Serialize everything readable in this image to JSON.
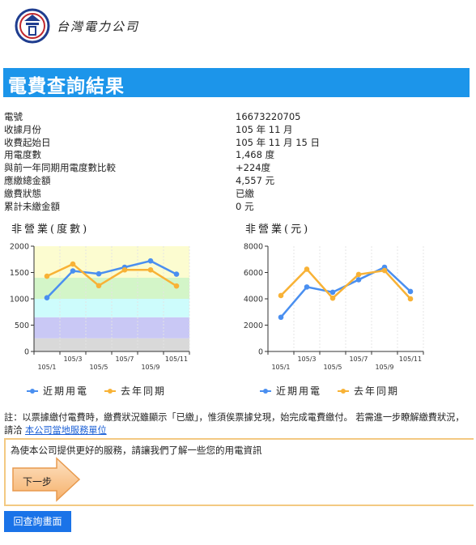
{
  "logo": {
    "company": "台灣電力公司"
  },
  "page_title": "電費查詢結果",
  "info": [
    {
      "label": "電號",
      "value": "16673220705"
    },
    {
      "label": "收據月份",
      "value": "105 年 11 月"
    },
    {
      "label": "收費起始日",
      "value": "105 年 11 月 15 日"
    },
    {
      "label": "用電度數",
      "value": "1,468 度"
    },
    {
      "label": "與前一年同期用電度數比較",
      "value": "+224度"
    },
    {
      "label": "應繳總金額",
      "value": "4,557 元"
    },
    {
      "label": "繳費狀態",
      "value": "已繳"
    },
    {
      "label": "累計未繳金額",
      "value": "0 元"
    }
  ],
  "chart_data": [
    {
      "type": "line",
      "title": "非營業(度數)",
      "x": [
        "105/1",
        "105/3",
        "105/5",
        "105/7",
        "105/9",
        "105/11"
      ],
      "ylim": [
        0,
        2000
      ],
      "yticks": [
        0,
        500,
        1000,
        1500,
        2000
      ],
      "series": [
        {
          "name": "近期用電",
          "color": "#4a8ff0",
          "values": [
            1020,
            1530,
            1475,
            1600,
            1720,
            1468
          ]
        },
        {
          "name": "去年同期",
          "color": "#f8b236",
          "values": [
            1430,
            1660,
            1250,
            1550,
            1550,
            1244
          ]
        }
      ],
      "bands": [
        {
          "from": 0,
          "to": 250,
          "color": "#d9d9d9"
        },
        {
          "from": 250,
          "to": 650,
          "color": "#c9c8f5"
        },
        {
          "from": 650,
          "to": 1000,
          "color": "#cdfcfc"
        },
        {
          "from": 1000,
          "to": 1400,
          "color": "#d3f5c8"
        },
        {
          "from": 1400,
          "to": 2000,
          "color": "#fcfcd0"
        }
      ]
    },
    {
      "type": "line",
      "title": "非營業(元)",
      "x": [
        "105/1",
        "105/3",
        "105/5",
        "105/7",
        "105/9",
        "105/11"
      ],
      "ylim": [
        0,
        8000
      ],
      "yticks": [
        0,
        2000,
        4000,
        6000,
        8000
      ],
      "series": [
        {
          "name": "近期用電",
          "color": "#4a8ff0",
          "values": [
            2600,
            4900,
            4500,
            5450,
            6400,
            4557
          ]
        },
        {
          "name": "去年同期",
          "color": "#f8b236",
          "values": [
            4250,
            6250,
            4050,
            5850,
            6150,
            4000
          ]
        }
      ]
    }
  ],
  "legend": {
    "recent": "近期用電",
    "last_year": "去年同期"
  },
  "note": {
    "text": "註：以票據繳付電費時，繳費狀況雖顯示「已繳」，惟須俟票據兌現，始完成電費繳付。 若需進一步瞭解繳費狀況，請洽 ",
    "link": "本公司當地服務單位"
  },
  "survey": {
    "question": "為使本公司提供更好的服務，請讓我們了解一些您的用電資訊",
    "next_label": "下一步"
  },
  "back_button": "回查詢畫面"
}
